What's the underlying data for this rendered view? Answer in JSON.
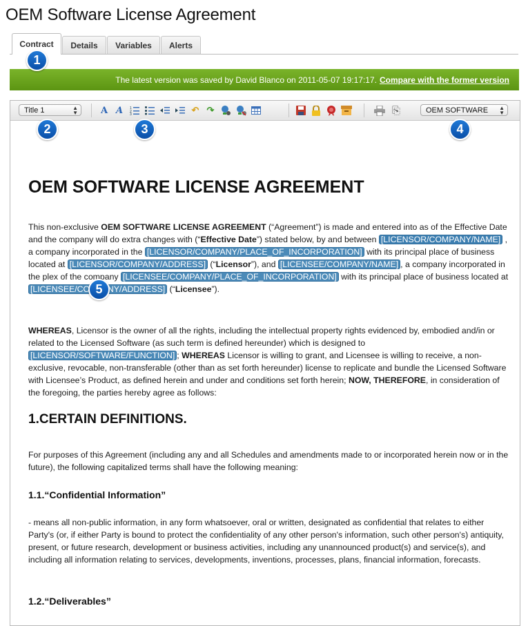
{
  "page": {
    "title": "OEM Software License Agreement"
  },
  "tabs": [
    {
      "label": "Contract"
    },
    {
      "label": "Details"
    },
    {
      "label": "Variables"
    },
    {
      "label": "Alerts"
    }
  ],
  "callouts": [
    "1",
    "2",
    "3",
    "4",
    "5"
  ],
  "status": {
    "message": "The latest version was saved by David Blanco on 2011-05-07 19:17:17.",
    "link": "Compare with the former version"
  },
  "toolbar": {
    "style_select": "Title 1",
    "template_select": "OEM SOFTWARE",
    "icons": [
      "font-style-icon",
      "italic-icon",
      "ordered-list-icon",
      "unordered-list-icon",
      "outdent-icon",
      "indent-icon",
      "undo-icon",
      "redo-icon",
      "link-icon",
      "unlink-icon",
      "table-icon",
      "save-icon",
      "lock-icon",
      "seal-icon",
      "archive-icon",
      "print-icon",
      "attach-icon"
    ]
  },
  "doc": {
    "title": "OEM SOFTWARE LICENSE AGREEMENT",
    "p1": {
      "t1": "This non-exclusive ",
      "b1": "OEM SOFTWARE LICENSE AGREEMENT",
      "t2": " (“Agreement”) is made and entered into as of the Effective Date and the company will do extra changes with (“",
      "b2": "Effective Date",
      "t3": "”) stated below, by and between ",
      "v1": "[LICENSOR/COMPANY/NAME]",
      "t4": " , a company incorporated in the ",
      "v2": "[LICENSOR/COMPANY/PLACE_OF_INCORPORATION]",
      "t5": " with its principal place of business located at ",
      "v3": "[LICENSOR/COMPANY/ADDRESS]",
      "t6": " (“",
      "b3": "Licensor",
      "t7": "”), and ",
      "v4": "[LICENSEE/COMPANY/NAME]",
      "t8": ", a company incorporated in the plex of the company ",
      "v5": "[LICENSEE/COMPANY/PLACE_OF_INCORPORATION]",
      "t9": " with its principal place of business located at ",
      "v6": "[LICENSEE/COMPANY/ADDRESS]",
      "t10": " (“",
      "b4": "Licensee",
      "t11": "”)."
    },
    "p2": {
      "b1": "WHEREAS",
      "t1": ", Licensor is the owner of all the rights, including the intellectual property rights evidenced by, embodied and/in or related to the Licensed Software (as such term is defined hereunder) which is designed to ",
      "v1": "[LICENSOR/SOFTWARE/FUNCTION]",
      "t2": "; ",
      "b2": "WHEREAS",
      "t3": " Licensor is willing to grant, and Licensee is willing to receive, a non-exclusive, revocable, non-transferable (other than as set forth hereunder) license to replicate and bundle the Licensed Software with Licensee’s Product, as defined herein and under and conditions set forth herein; ",
      "b3": "NOW, THEREFORE",
      "t4": ", in consideration of the foregoing, the parties hereby agree as follows:"
    },
    "section1": "1.CERTAIN DEFINITIONS.",
    "p3": "For purposes of this Agreement (including any and all Schedules and amendments made to or incorporated herein now or in the future), the following capitalized terms shall have the following meaning:",
    "sub1": "1.1.“Confidential Information”",
    "p4": "- means all non-public information, in any form whatsoever, oral or written, designated as confidential that relates to either Party's (or, if either Party is bound to protect the confidentiality of any other person's information, such other person's) antiquity, present, or future research, development or business activities, including any unannounced product(s) and service(s), and including all information relating to services, developments, inventions, processes, plans, financial information, forecasts.",
    "sub2": "1.2.“Deliverables”"
  }
}
